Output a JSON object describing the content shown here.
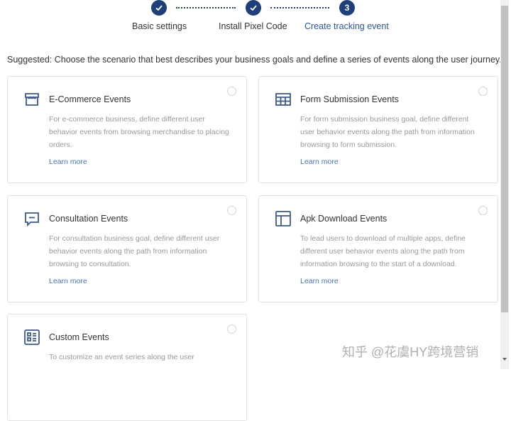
{
  "stepper": {
    "steps": [
      {
        "label": "Basic settings",
        "status": "done",
        "icon": "check-icon"
      },
      {
        "label": "Install Pixel Code",
        "status": "done",
        "icon": "check-icon"
      },
      {
        "label": "Create tracking event",
        "status": "active",
        "number": "3"
      }
    ],
    "color": "#1f3f7a"
  },
  "suggestion": "Suggested: Choose the scenario that best describes your business goals and define a series of events along the user journey.",
  "cards": [
    {
      "title": "E-Commerce Events",
      "icon": "storefront-icon",
      "desc": "For e-commerce business, define different user behavior events from browsing merchandise to placing orders.",
      "link": "Learn more"
    },
    {
      "title": "Form Submission Events",
      "icon": "table-grid-icon",
      "desc": "For form submission business goal, define different user behavior events along the path from information browsing to form submission.",
      "link": "Learn more"
    },
    {
      "title": "Consultation Events",
      "icon": "chat-bubble-icon",
      "desc": "For consultation business goal, define different user behavior events along the path from information browsing to consultation.",
      "link": "Learn more"
    },
    {
      "title": "Apk Download Events",
      "icon": "layout-panel-icon",
      "desc": "To lead users to download of multiple apps, define different user behavior events along the path from information browsing to the start of a download.",
      "link": "Learn more"
    },
    {
      "title": "Custom Events",
      "icon": "list-checklist-icon",
      "desc": "To customize an event series along the user"
    }
  ],
  "watermark": "知乎 @花虞HY跨境营销"
}
